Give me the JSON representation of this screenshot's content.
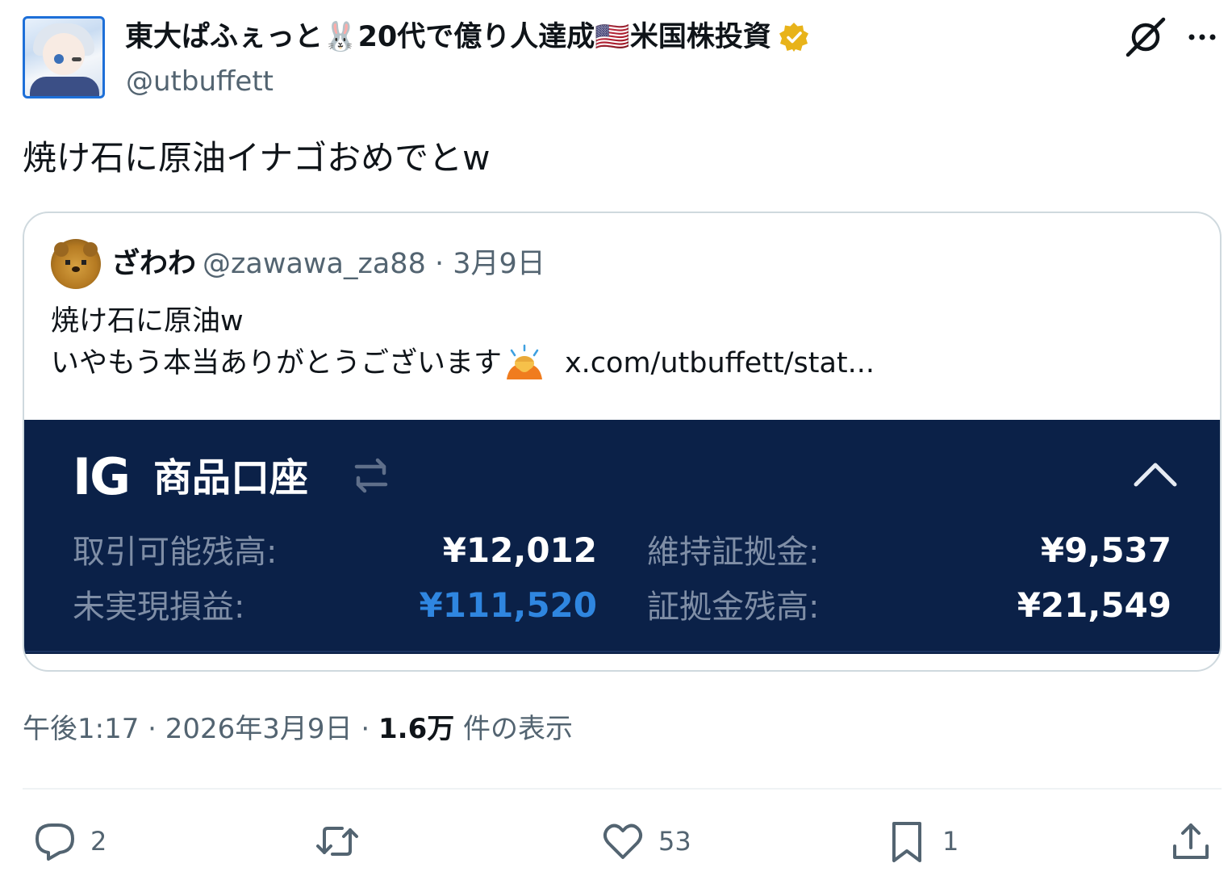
{
  "author": {
    "display_name": "東大ぱふぇっと🐰20代で億り人達成🇺🇸米国株投資",
    "handle": "@utbuffett",
    "verified_icon": "gold-verified-badge-icon"
  },
  "header_icons": [
    "grok-icon",
    "more-icon"
  ],
  "tweet": {
    "text": "焼け石に原油イナゴおめでとw",
    "timestamp": "午後1:17 · 2026年3月9日 · ",
    "views_count": "1.6万",
    "views_label": " 件の表示"
  },
  "quoted_tweet": {
    "name": "ざわわ",
    "handle": "@zawawa_za88",
    "date": " · 3月9日",
    "line1": "焼け石に原油w",
    "line2": "いやもう本当ありがとうございます",
    "emoji": "bowing-person-emoji",
    "link": "x.com/utbuffett/stat..."
  },
  "ig_panel": {
    "logo": "IG",
    "title": "商品口座",
    "available_label": "取引可能残高:",
    "available_value": "¥12,012",
    "margin_label": "維持証拠金:",
    "margin_value": "¥9,537",
    "unrealized_label": "未実現損益:",
    "unrealized_value": "¥111,520",
    "margin_balance_label": "証拠金残高:",
    "margin_balance_value": "¥21,549",
    "colors": {
      "background": "#0b2148",
      "positive": "#2f86e0"
    }
  },
  "actions": {
    "reply_count": "2",
    "retweet_count": "",
    "like_count": "53",
    "bookmark_count": "1"
  }
}
